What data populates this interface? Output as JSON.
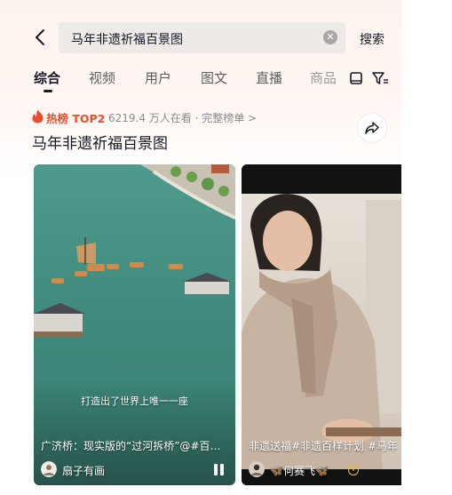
{
  "search": {
    "query": "马年非遗祈福百景图",
    "clear_icon": "close-circle-icon",
    "submit_label": "搜索"
  },
  "tabs": [
    {
      "label": "综合",
      "active": true
    },
    {
      "label": "视频"
    },
    {
      "label": "用户"
    },
    {
      "label": "图文"
    },
    {
      "label": "直播"
    },
    {
      "label": "商品"
    }
  ],
  "hot": {
    "rank_label": "热榜 TOP2",
    "meta": "6219.4 万人在看 · 完整榜单 >",
    "title": "马年非遗祈福百景图"
  },
  "cards": [
    {
      "caption": "打造出了世界上唯一一座",
      "description": "广济桥：现实版的“过河拆桥”@#百…",
      "author": "扇子有画"
    },
    {
      "description": "非遗送福#非遗百样计划 #马年",
      "author": "🦋何赛飞🦋"
    }
  ],
  "colors": {
    "accent": "#f04b2a",
    "text": "#161823",
    "muted": "#8a8b91"
  }
}
